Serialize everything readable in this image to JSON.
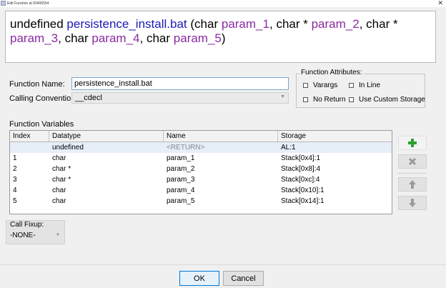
{
  "window": {
    "title": "Edit Function at 00406554"
  },
  "signature": {
    "return_type": "undefined",
    "function_name": "persistence_install.bat",
    "params": [
      {
        "type": "char",
        "name": "param_1"
      },
      {
        "type": "char *",
        "name": "param_2"
      },
      {
        "type": "char *",
        "name": "param_3"
      },
      {
        "type": "char",
        "name": "param_4"
      },
      {
        "type": "char",
        "name": "param_5"
      }
    ]
  },
  "form": {
    "function_name_label": "Function Name:",
    "function_name_value": "persistence_install.bat",
    "calling_convention_label": "Calling Convention",
    "calling_convention_value": "__cdecl"
  },
  "attributes": {
    "title": "Function Attributes:",
    "varargs": "Varargs",
    "inline": "In Line",
    "no_return": "No Return",
    "custom_storage": "Use Custom Storage"
  },
  "variables": {
    "title": "Function Variables",
    "columns": [
      "Index",
      "Datatype",
      "Name",
      "Storage"
    ],
    "rows": [
      {
        "index": "",
        "datatype": "undefined",
        "name": "<RETURN>",
        "storage": "AL:1"
      },
      {
        "index": "1",
        "datatype": "char",
        "name": "param_1",
        "storage": "Stack[0x4]:1"
      },
      {
        "index": "2",
        "datatype": "char *",
        "name": "param_2",
        "storage": "Stack[0x8]:4"
      },
      {
        "index": "3",
        "datatype": "char *",
        "name": "param_3",
        "storage": "Stack[0xc]:4"
      },
      {
        "index": "4",
        "datatype": "char",
        "name": "param_4",
        "storage": "Stack[0x10]:1"
      },
      {
        "index": "5",
        "datatype": "char",
        "name": "param_5",
        "storage": "Stack[0x14]:1"
      }
    ]
  },
  "call_fixup": {
    "label": "Call Fixup:",
    "value": "-NONE-"
  },
  "buttons": {
    "ok": "OK",
    "cancel": "Cancel"
  },
  "colors": {
    "function_name": "#1a1ab5",
    "param_name": "#8b2ba3",
    "add_icon": "#2e9e2e",
    "disabled_icon": "#9a9a9a"
  },
  "icons": {
    "close": "close-icon",
    "add": "plus-icon",
    "delete": "x-icon",
    "up": "arrow-up-icon",
    "down": "arrow-down-icon"
  }
}
